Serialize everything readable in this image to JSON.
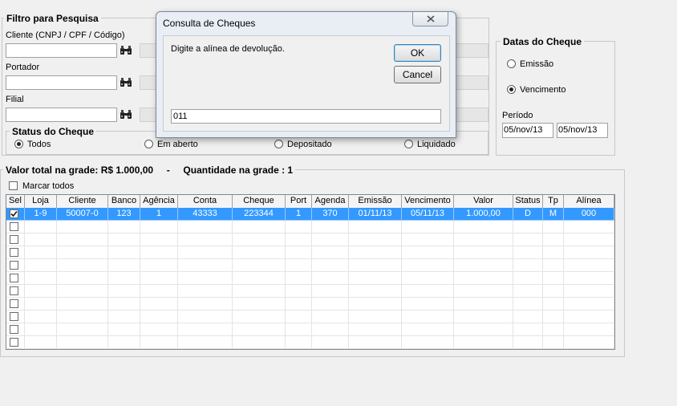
{
  "filter": {
    "title": "Filtro para Pesquisa",
    "client_label": "Cliente (CNPJ / CPF / Código)",
    "portador_label": "Portador",
    "filial_label": "Filial",
    "client_value": "",
    "portador_value": "",
    "filial_value": "",
    "search_icon": "binoculars-icon"
  },
  "status": {
    "title": "Status do Cheque",
    "options": [
      "Todos",
      "Em aberto",
      "Depositado",
      "Liquidado"
    ],
    "selected": "Todos"
  },
  "dates": {
    "title": "Datas do Cheque",
    "options": [
      "Emissão",
      "Vencimento"
    ],
    "selected": "Vencimento",
    "period_label": "Período",
    "period_start": "05/nov/13",
    "period_end": "05/nov/13"
  },
  "summary": {
    "title": "Valor total na grade: R$ 1.000,00     -     Quantidade na grade : 1",
    "mark_all_label": "Marcar todos",
    "mark_all_checked": false
  },
  "grid": {
    "columns": [
      "Sel",
      "Loja",
      "Cliente",
      "Banco",
      "Agência",
      "Conta",
      "Cheque",
      "Port",
      "Agenda",
      "Emissão",
      "Vencimento",
      "Valor",
      "Status",
      "Tp",
      "Alínea"
    ],
    "rows": [
      {
        "selected": true,
        "cells": [
          "",
          "1-9",
          "50007-0",
          "123",
          "1",
          "43333",
          "223344",
          "1",
          "370",
          "01/11/13",
          "05/11/13",
          "1.000,00",
          "D",
          "M",
          "000"
        ]
      }
    ],
    "empty_rows": 10
  },
  "dialog": {
    "title": "Consulta de Cheques",
    "prompt": "Digite a alínea de devolução.",
    "ok_label": "OK",
    "cancel_label": "Cancel",
    "input_value": "011",
    "close_icon": "close-icon"
  }
}
